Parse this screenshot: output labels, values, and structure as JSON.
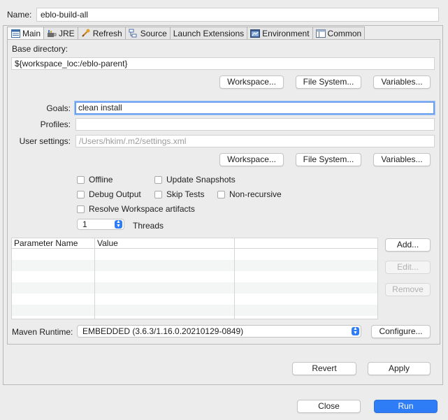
{
  "name": {
    "label": "Name:",
    "value": "eblo-build-all"
  },
  "tabs": [
    {
      "label": "Main",
      "icon": "main-tab-icon",
      "active": true
    },
    {
      "label": "JRE",
      "icon": "jre-icon"
    },
    {
      "label": "Refresh",
      "icon": "refresh-icon"
    },
    {
      "label": "Source",
      "icon": "source-icon"
    },
    {
      "label": "Launch Extensions",
      "icon": ""
    },
    {
      "label": "Environment",
      "icon": "environment-icon"
    },
    {
      "label": "Common",
      "icon": "common-icon"
    }
  ],
  "base_directory": {
    "label": "Base directory:",
    "value": "${workspace_loc:/eblo-parent}",
    "buttons": {
      "workspace": "Workspace...",
      "file_system": "File System...",
      "variables": "Variables..."
    }
  },
  "goals": {
    "label": "Goals:",
    "value": "clean install"
  },
  "profiles": {
    "label": "Profiles:",
    "value": ""
  },
  "user_settings": {
    "label": "User settings:",
    "placeholder": "/Users/hkim/.m2/settings.xml",
    "buttons": {
      "workspace": "Workspace...",
      "file_system": "File System...",
      "variables": "Variables..."
    }
  },
  "options": {
    "offline": "Offline",
    "update_snapshots": "Update Snapshots",
    "debug_output": "Debug Output",
    "skip_tests": "Skip Tests",
    "non_recursive": "Non-recursive",
    "resolve_workspace": "Resolve Workspace artifacts"
  },
  "threads": {
    "value": "1",
    "label": "Threads"
  },
  "param_table": {
    "columns": [
      "Parameter Name",
      "Value"
    ],
    "buttons": {
      "add": "Add...",
      "edit": "Edit...",
      "remove": "Remove"
    }
  },
  "maven_runtime": {
    "label": "Maven Runtime:",
    "value": "EMBEDDED (3.6.3/1.16.0.20210129-0849)",
    "configure": "Configure..."
  },
  "footer": {
    "revert": "Revert",
    "apply": "Apply",
    "close": "Close",
    "run": "Run"
  },
  "colors": {
    "accent": "#2f7df6",
    "focus": "#6aa0ee"
  }
}
